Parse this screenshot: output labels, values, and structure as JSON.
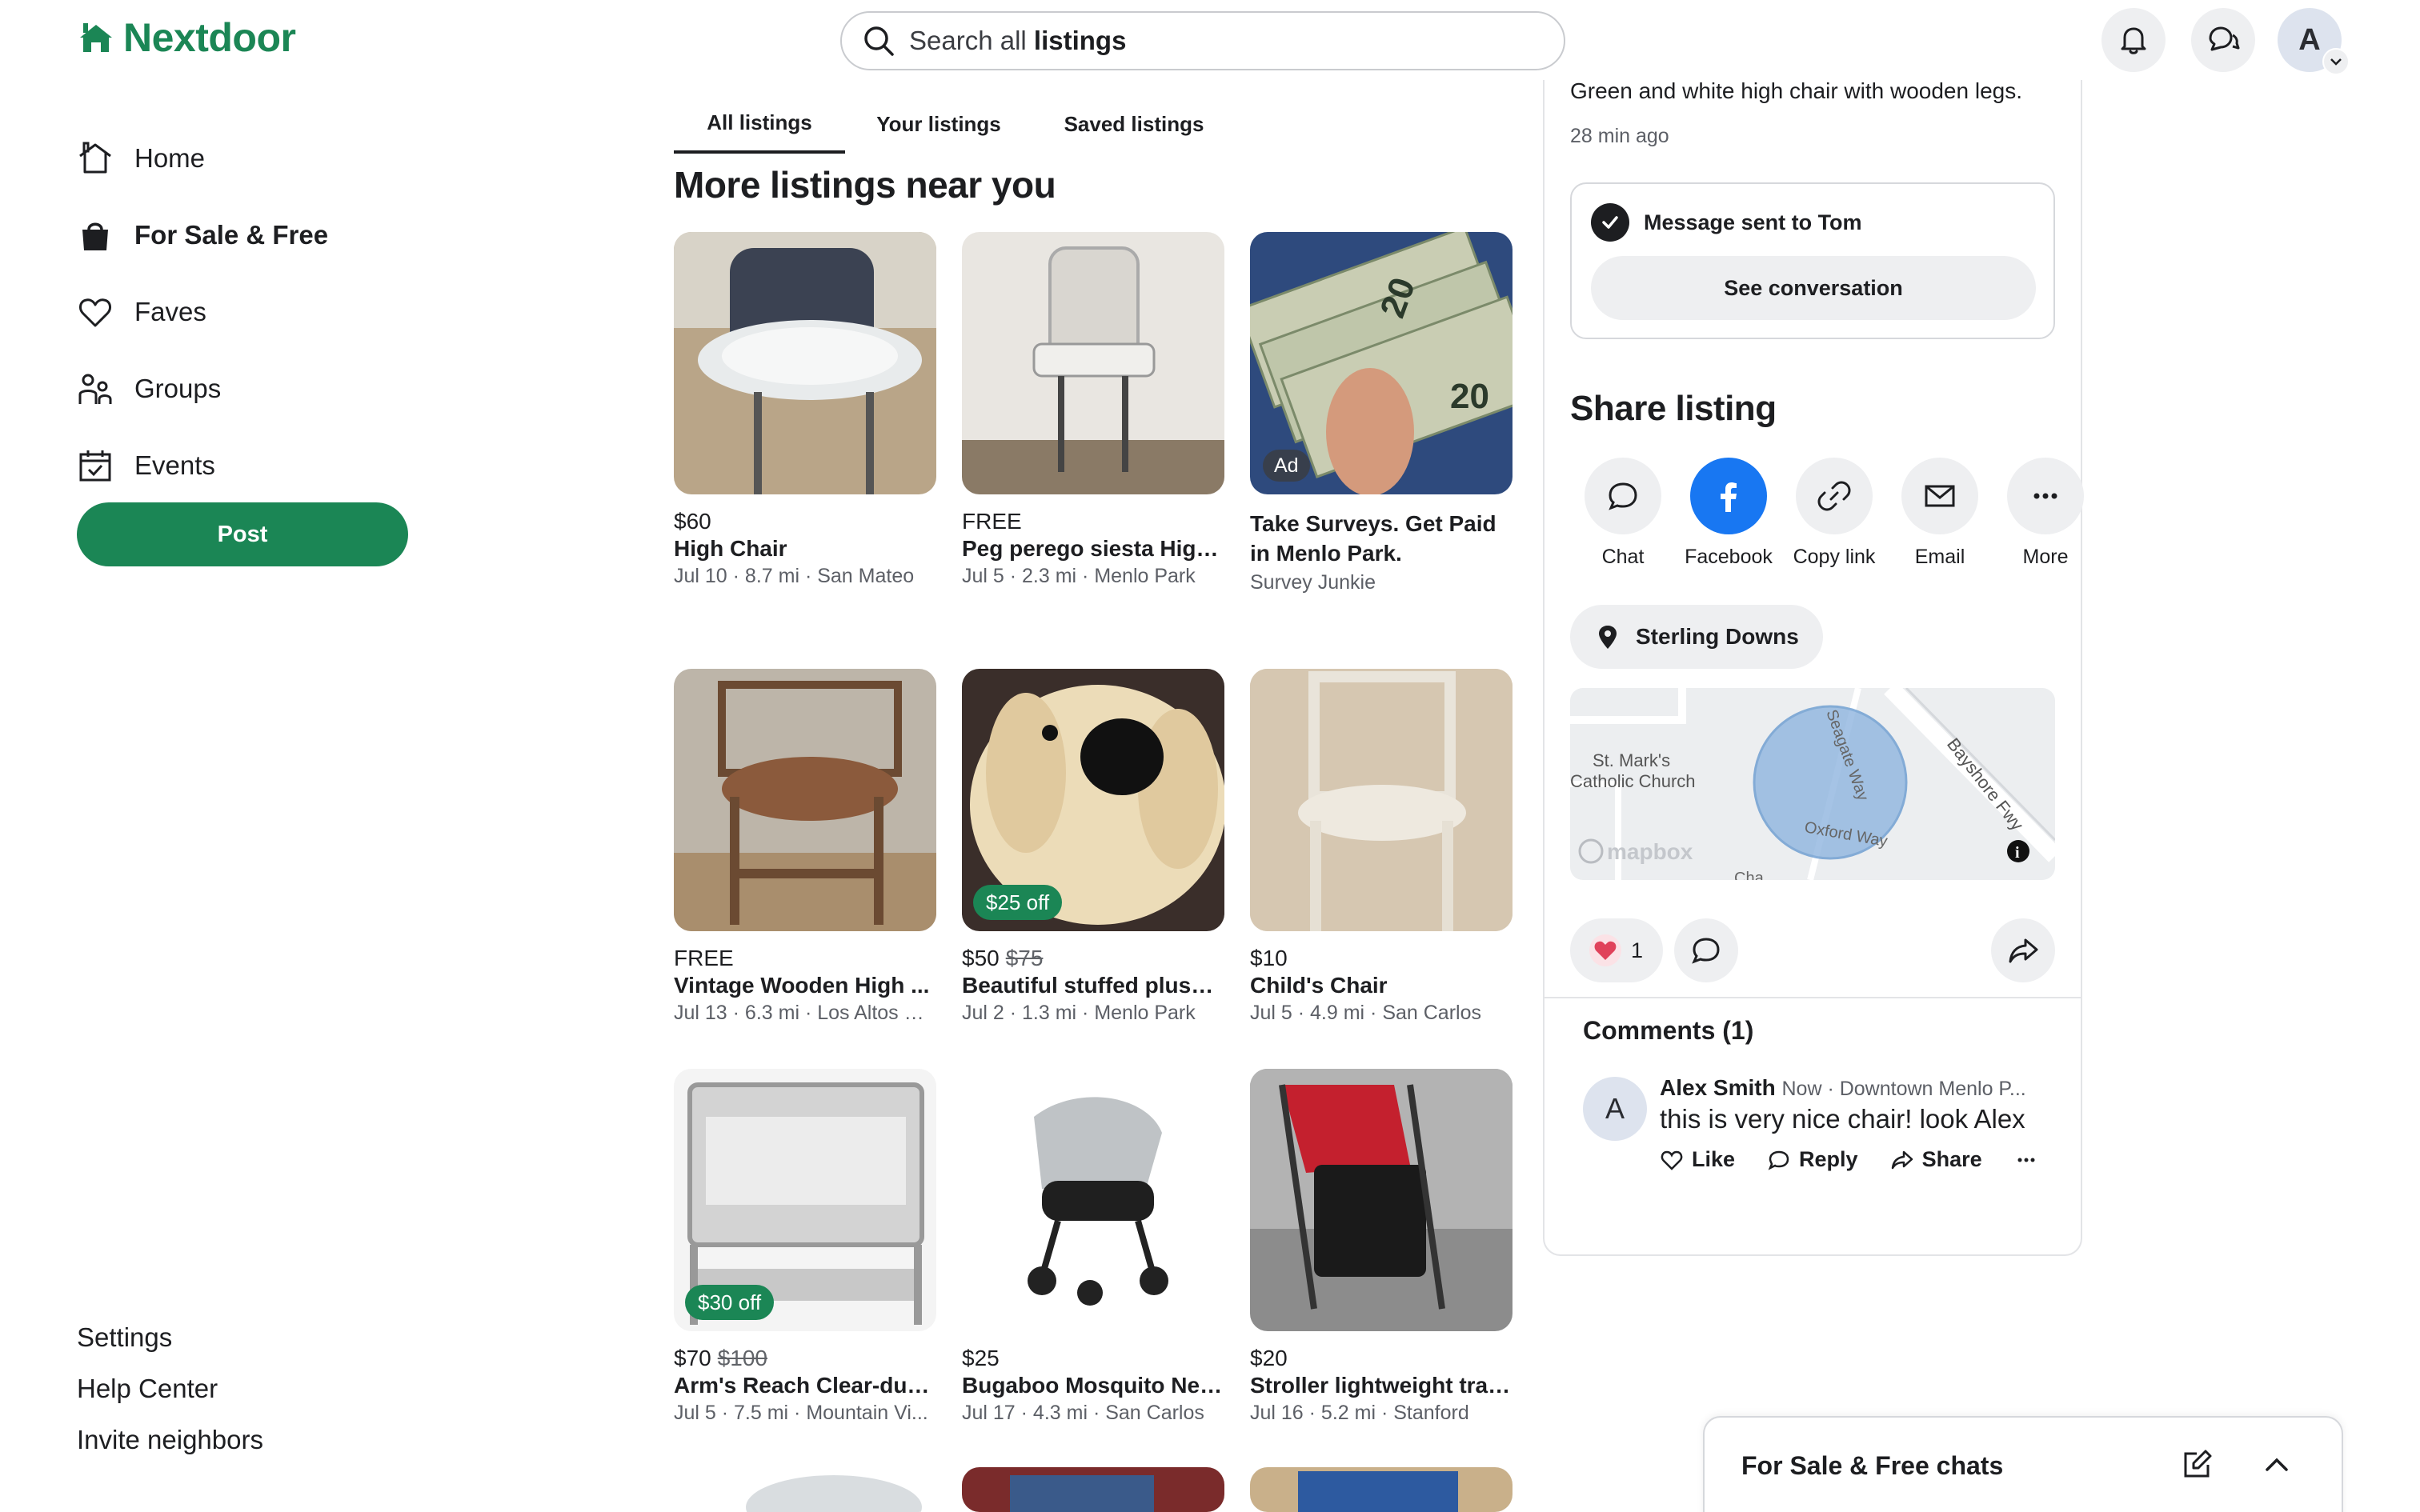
{
  "app": {
    "name": "Nextdoor",
    "brand_color": "#1b8655"
  },
  "search": {
    "prefix": "Search all ",
    "bold": "listings"
  },
  "user": {
    "initial": "A"
  },
  "nav": {
    "items": [
      {
        "label": "Home",
        "icon": "home-icon"
      },
      {
        "label": "For Sale & Free",
        "icon": "shopping-bag-icon",
        "active": true
      },
      {
        "label": "Faves",
        "icon": "heart-icon"
      },
      {
        "label": "Groups",
        "icon": "people-icon"
      },
      {
        "label": "Events",
        "icon": "calendar-icon"
      }
    ],
    "post_label": "Post",
    "footer": [
      "Settings",
      "Help Center",
      "Invite neighbors"
    ]
  },
  "tabs": [
    "All listings",
    "Your listings",
    "Saved listings"
  ],
  "section_title": "More listings near you",
  "listings": [
    {
      "price": "$60",
      "title": "High Chair",
      "meta": "Jul 10 · 8.7 mi · San Mateo"
    },
    {
      "price": "FREE",
      "title": "Peg perego siesta High ...",
      "meta": "Jul 5 · 2.3 mi · Menlo Park"
    },
    {
      "ad": true,
      "ad_badge": "Ad",
      "title": "Take Surveys. Get Paid in Menlo Park.",
      "meta": "Survey Junkie"
    },
    {
      "price": "FREE",
      "title": "Vintage Wooden High ...",
      "meta": "Jul 13 · 6.3 mi · Los Altos Hi..."
    },
    {
      "price": "$50",
      "old_price": "$75",
      "badge": "$25 off",
      "title": "Beautiful stuffed plush ...",
      "meta": "Jul 2 · 1.3 mi · Menlo Park"
    },
    {
      "price": "$10",
      "title": "Child's Chair",
      "meta": "Jul 5 · 4.9 mi · San Carlos"
    },
    {
      "price": "$70",
      "old_price": "$100",
      "badge": "$30 off",
      "title": "Arm's Reach Clear-due ...",
      "meta": "Jul 5 · 7.5 mi · Mountain Vi..."
    },
    {
      "price": "$25",
      "title": "Bugaboo Mosquito Net ...",
      "meta": "Jul 17 · 4.3 mi · San Carlos"
    },
    {
      "price": "$20",
      "title": "Stroller lightweight travel",
      "meta": "Jul 16 · 5.2 mi · Stanford"
    }
  ],
  "detail": {
    "description": "Green and white high chair with wooden legs.",
    "time_ago": "28 min ago",
    "message_sent": "Message sent to Tom",
    "see_conversation": "See conversation",
    "share_title": "Share listing",
    "share_options": [
      "Chat",
      "Facebook",
      "Copy link",
      "Email",
      "More"
    ],
    "location": "Sterling Downs",
    "map_labels": {
      "church": "St. Mark's",
      "church2": "Catholic Church",
      "street1": "Seagate Way",
      "street2": "Oxford Way",
      "highway": "Bayshore Fwy",
      "cut": "Cha",
      "attribution": "mapbox"
    },
    "reaction_count": "1",
    "comments_title": "Comments (1)",
    "comment": {
      "initial": "A",
      "author": "Alex Smith",
      "meta": "Now · Downtown Menlo P...",
      "text": "this is very nice chair!  look Alex",
      "actions": [
        "Like",
        "Reply",
        "Share"
      ]
    }
  },
  "chat_dock": {
    "title": "For Sale & Free chats"
  }
}
